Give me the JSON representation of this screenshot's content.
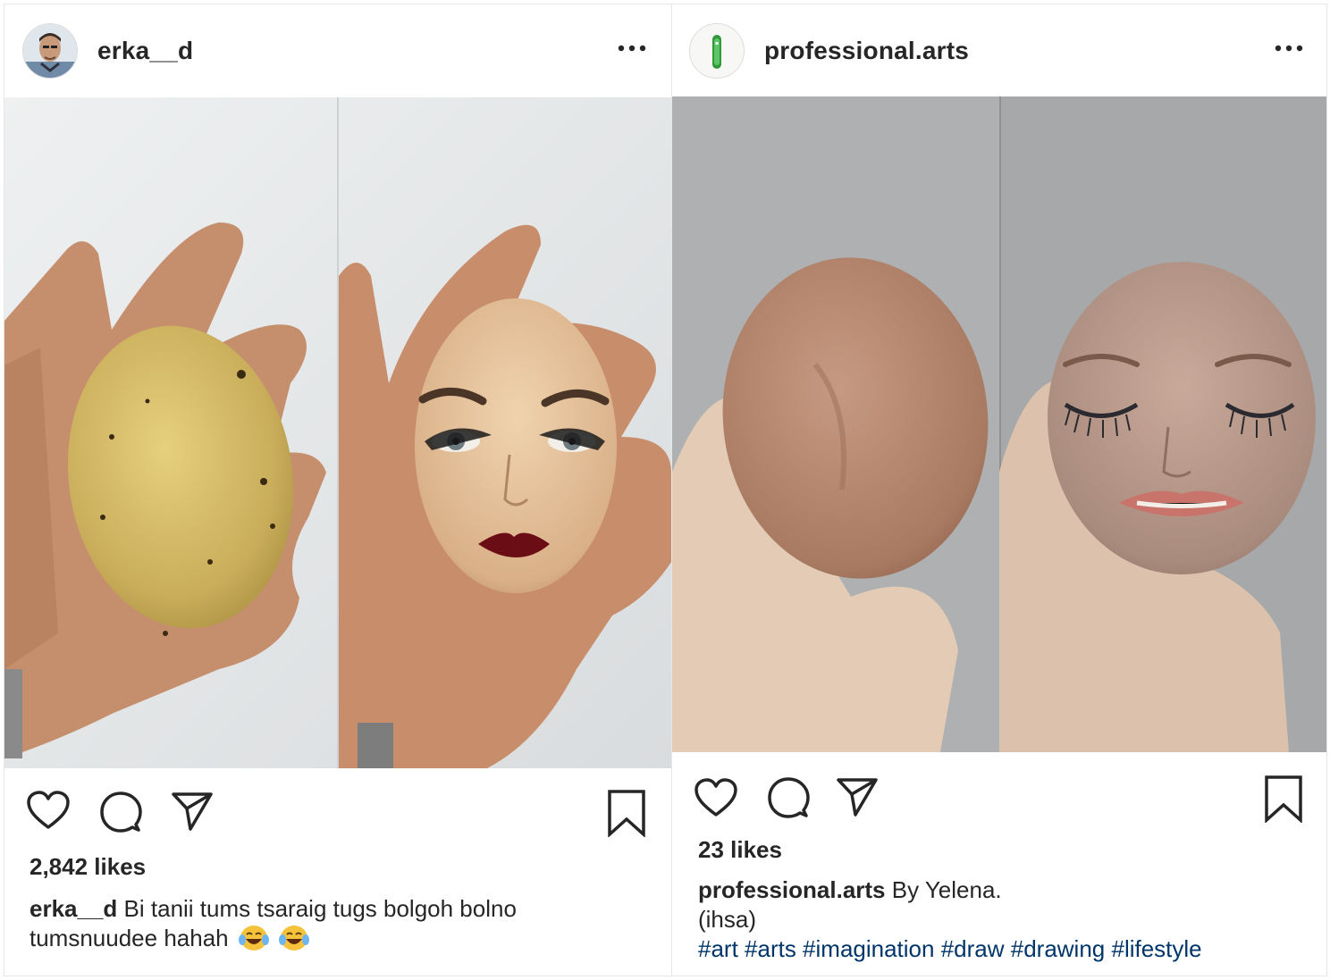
{
  "post_left": {
    "username": "erka__d",
    "likes": "2,842 likes",
    "caption_user": "erka__d",
    "caption_line1": "Bi tanii tums tsaraig tugs bolgoh bolno",
    "caption_line2": "tumsnuudee hahah",
    "emojis": [
      "laughing-crying-emoji",
      "laughing-crying-emoji"
    ]
  },
  "post_right": {
    "username": "professional.arts",
    "likes": "23 likes",
    "caption_user": "professional.arts",
    "caption_text": "By Yelena.",
    "caption_line2": "(ihsa)",
    "hashtags": "#art #arts #imagination #draw #drawing #lifestyle"
  },
  "icons": [
    "more-options-icon",
    "heart-icon",
    "comment-icon",
    "share-icon",
    "bookmark-icon"
  ],
  "colors": {
    "text": "#262626",
    "hashtag": "#003569",
    "border": "#e6e6e6"
  }
}
